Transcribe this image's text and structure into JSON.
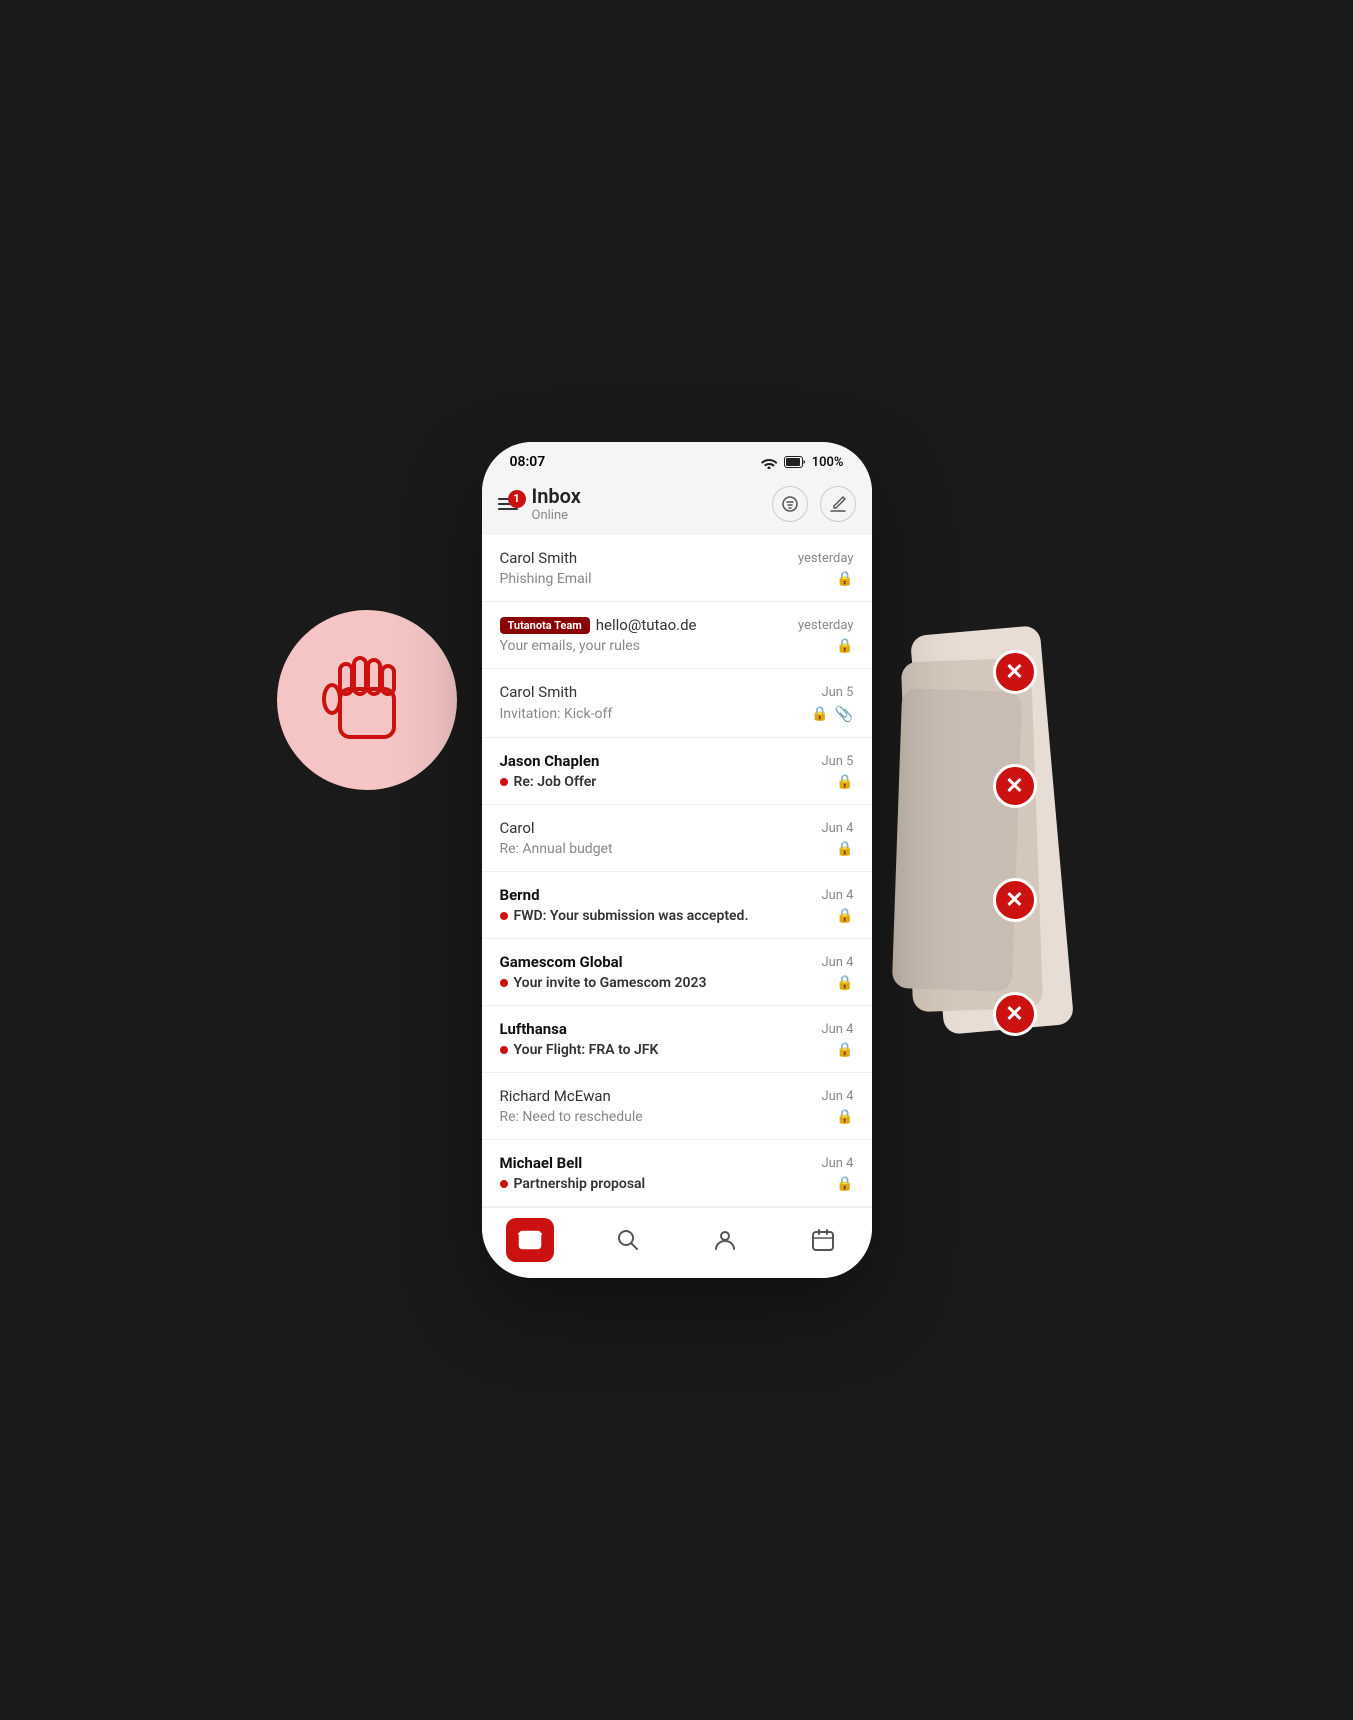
{
  "status": {
    "time": "08:07",
    "battery": "100%"
  },
  "header": {
    "badge_count": "1",
    "title": "Inbox",
    "subtitle": "Online",
    "filter_icon": "☰",
    "search_icon": "⊕",
    "compose_icon": "✎"
  },
  "emails": [
    {
      "id": 1,
      "sender": "Carol Smith",
      "sender_bold": false,
      "date": "yesterday",
      "preview": "Phishing Email",
      "preview_bold": false,
      "unread": false,
      "lock": true,
      "attachment": false,
      "tutanota_badge": false
    },
    {
      "id": 2,
      "sender": "hello@tutao.de",
      "sender_bold": false,
      "date": "yesterday",
      "preview": "Your emails, your rules",
      "preview_bold": false,
      "unread": false,
      "lock": true,
      "attachment": false,
      "tutanota_badge": true
    },
    {
      "id": 3,
      "sender": "Carol Smith",
      "sender_bold": false,
      "date": "Jun 5",
      "preview": "Invitation: Kick-off",
      "preview_bold": false,
      "unread": false,
      "lock": true,
      "attachment": true,
      "tutanota_badge": false
    },
    {
      "id": 4,
      "sender": "Jason Chaplen",
      "sender_bold": true,
      "date": "Jun 5",
      "preview": "Re: Job Offer",
      "preview_bold": true,
      "unread": true,
      "lock": true,
      "attachment": false,
      "tutanota_badge": false
    },
    {
      "id": 5,
      "sender": "Carol",
      "sender_bold": false,
      "date": "Jun 4",
      "preview": "Re: Annual budget",
      "preview_bold": false,
      "unread": false,
      "lock": true,
      "attachment": false,
      "tutanota_badge": false
    },
    {
      "id": 6,
      "sender": "Bernd",
      "sender_bold": true,
      "date": "Jun 4",
      "preview": "FWD: Your submission was accepted.",
      "preview_bold": true,
      "unread": true,
      "lock": true,
      "attachment": false,
      "tutanota_badge": false
    },
    {
      "id": 7,
      "sender": "Gamescom Global",
      "sender_bold": true,
      "date": "Jun 4",
      "preview": "Your invite to Gamescom 2023",
      "preview_bold": true,
      "unread": true,
      "lock": true,
      "attachment": false,
      "tutanota_badge": false
    },
    {
      "id": 8,
      "sender": "Lufthansa",
      "sender_bold": true,
      "date": "Jun 4",
      "preview": "Your Flight: FRA to JFK",
      "preview_bold": true,
      "unread": true,
      "lock": true,
      "attachment": false,
      "tutanota_badge": false
    },
    {
      "id": 9,
      "sender": "Richard McEwan",
      "sender_bold": false,
      "date": "Jun 4",
      "preview": "Re: Need to reschedule",
      "preview_bold": false,
      "unread": false,
      "lock": true,
      "attachment": false,
      "tutanota_badge": false
    },
    {
      "id": 10,
      "sender": "Michael Bell",
      "sender_bold": true,
      "date": "Jun 4",
      "preview": "Partnership proposal",
      "preview_bold": true,
      "unread": true,
      "lock": true,
      "attachment": false,
      "tutanota_badge": false
    }
  ],
  "bottom_nav": [
    {
      "id": "mail",
      "icon": "✉",
      "active": true
    },
    {
      "id": "search",
      "icon": "⌕",
      "active": false
    },
    {
      "id": "contacts",
      "icon": "👤",
      "active": false
    },
    {
      "id": "calendar",
      "icon": "📅",
      "active": false
    }
  ],
  "x_buttons_count": 4,
  "tutanota_team_label": "Tutanota Team"
}
